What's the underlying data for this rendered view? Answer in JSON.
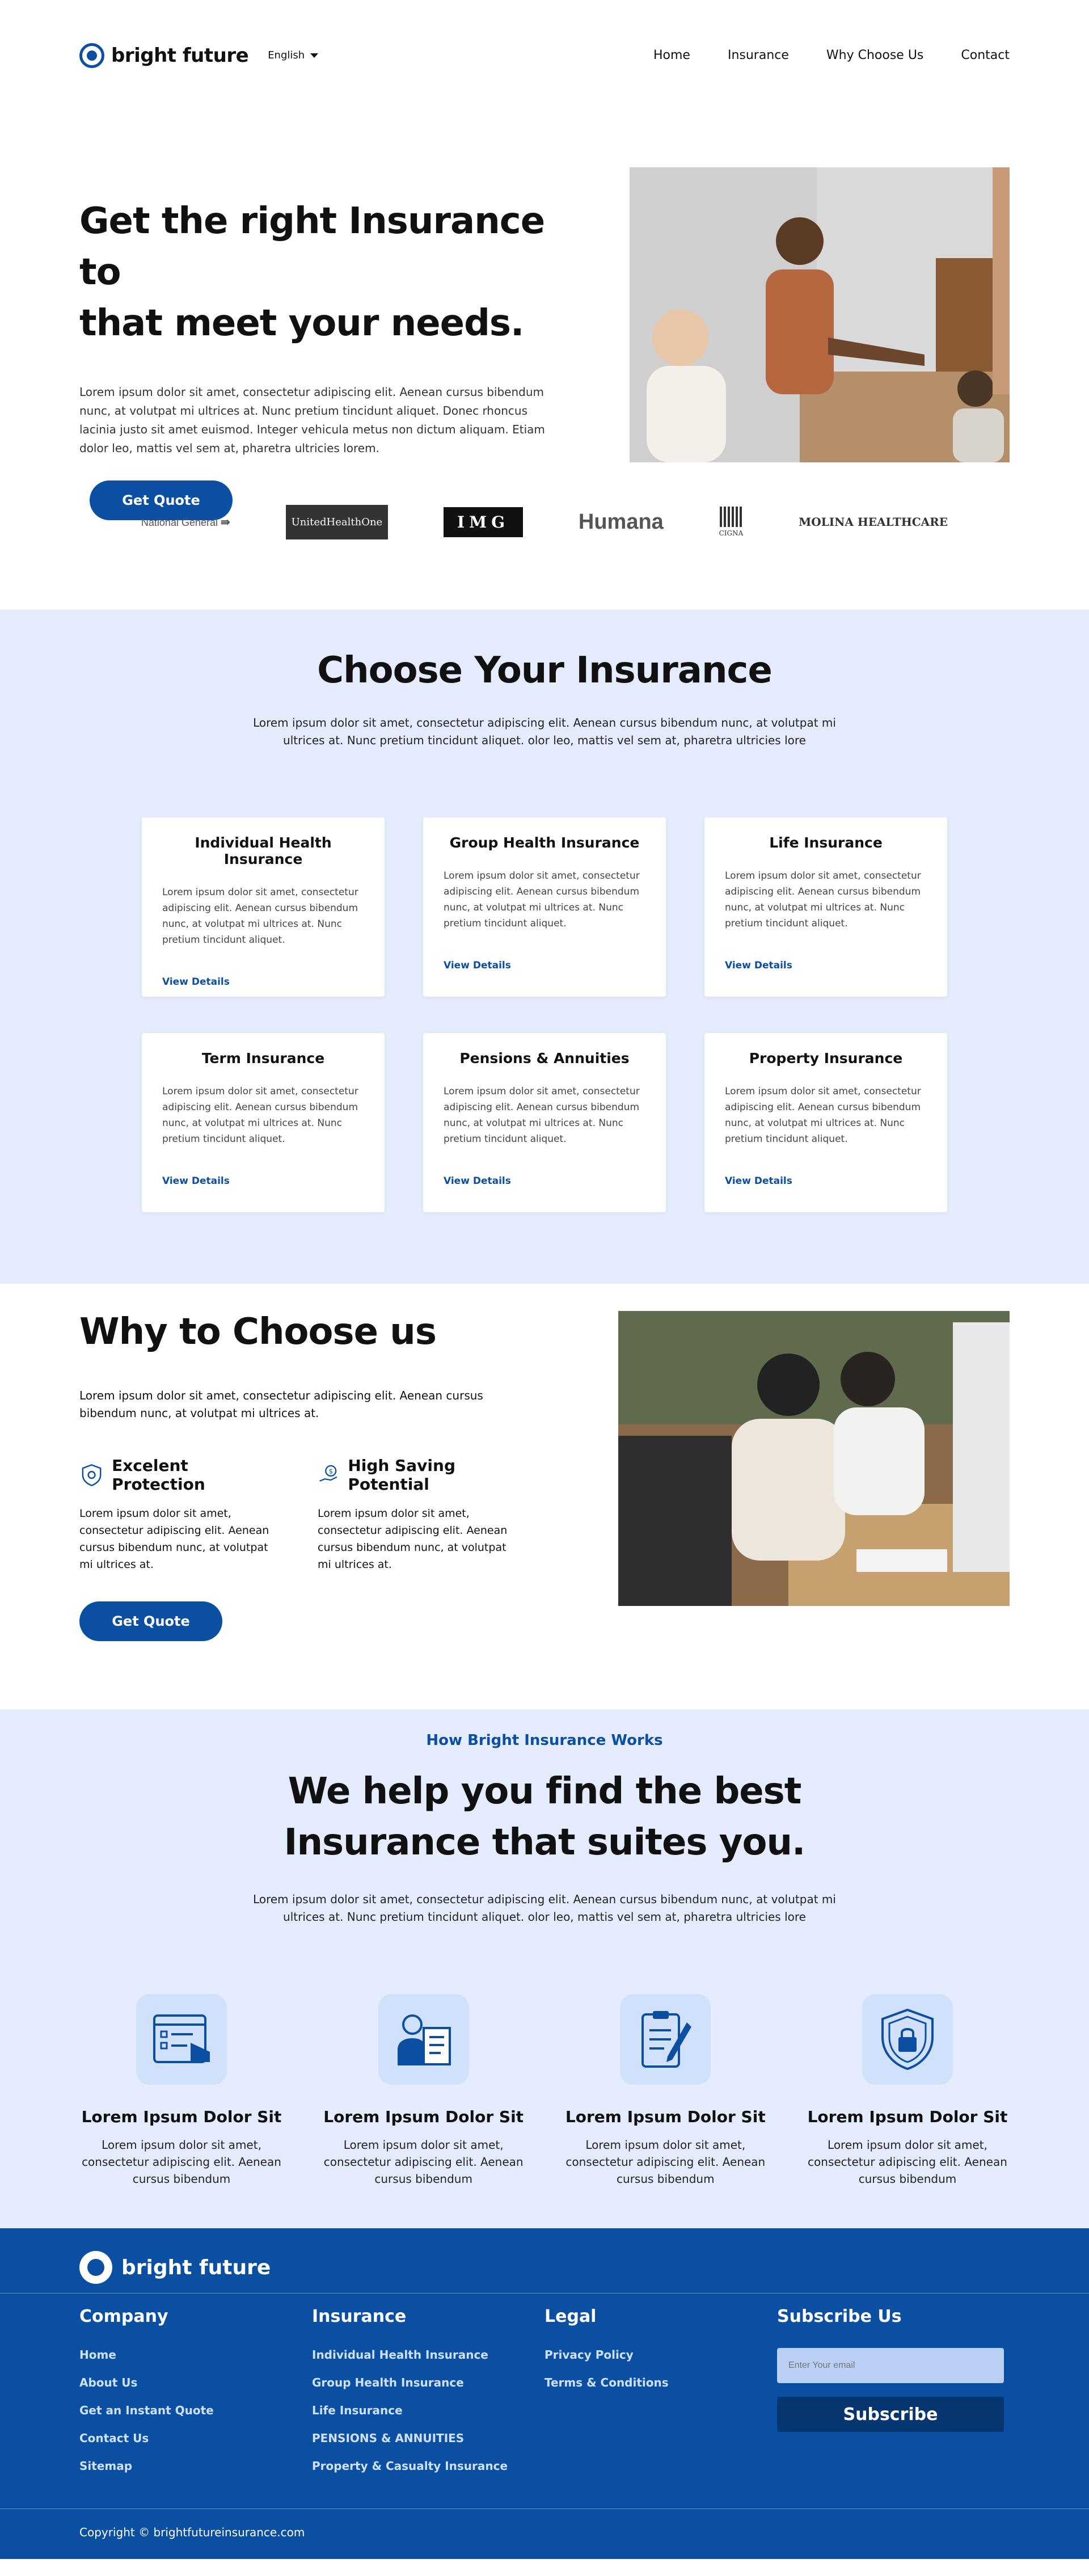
{
  "header": {
    "brand": "bright future",
    "language": "English",
    "nav": [
      "Home",
      "Insurance",
      "Why Choose Us",
      "Contact"
    ]
  },
  "hero": {
    "title_line1": "Get the right Insurance to",
    "title_line2": "that meet your needs.",
    "description": "Lorem ipsum dolor sit amet, consectetur adipiscing elit. Aenean cursus bibendum nunc, at volutpat mi ultrices at. Nunc pretium tincidunt aliquet. Donec rhoncus lacinia justo sit amet euismod. Integer vehicula metus non dictum aliquam. Etiam dolor leo, mattis vel sem at, pharetra ultricies lorem.",
    "cta": "Get Quote"
  },
  "logos": [
    "National General",
    "UnitedHealthOne",
    "IMG",
    "Humana",
    "CIGNA",
    "MOLINA HEALTHCARE"
  ],
  "choose": {
    "title": "Choose Your Insurance",
    "description": "Lorem ipsum dolor sit amet, consectetur adipiscing elit. Aenean cursus bibendum nunc, at volutpat mi ultrices at. Nunc pretium tincidunt aliquet. olor leo, mattis vel sem at, pharetra ultricies lore",
    "cards": [
      {
        "title": "Individual Health Insurance",
        "text": "Lorem ipsum dolor sit amet, consectetur adipiscing elit. Aenean cursus bibendum nunc, at volutpat mi ultrices at. Nunc pretium tincidunt aliquet.",
        "link": "View Details"
      },
      {
        "title": "Group Health Insurance",
        "text": "Lorem ipsum dolor sit amet, consectetur adipiscing elit. Aenean cursus bibendum nunc, at volutpat mi ultrices at. Nunc pretium tincidunt aliquet.",
        "link": "View Details"
      },
      {
        "title": "Life Insurance",
        "text": "Lorem ipsum dolor sit amet, consectetur adipiscing elit. Aenean cursus bibendum nunc, at volutpat mi ultrices at. Nunc pretium tincidunt aliquet.",
        "link": "View Details"
      },
      {
        "title": "Term Insurance",
        "text": "Lorem ipsum dolor sit amet, consectetur adipiscing elit. Aenean cursus bibendum nunc, at volutpat mi ultrices at. Nunc pretium tincidunt aliquet.",
        "link": "View Details"
      },
      {
        "title": "Pensions & Annuities",
        "text": "Lorem ipsum dolor sit amet, consectetur adipiscing elit. Aenean cursus bibendum nunc, at volutpat mi ultrices at. Nunc pretium tincidunt aliquet.",
        "link": "View Details"
      },
      {
        "title": "Property Insurance",
        "text": "Lorem ipsum dolor sit amet, consectetur adipiscing elit. Aenean cursus bibendum nunc, at volutpat mi ultrices at. Nunc pretium tincidunt aliquet.",
        "link": "View Details"
      }
    ]
  },
  "why": {
    "title": "Why to Choose us",
    "description": "Lorem ipsum dolor sit amet, consectetur adipiscing elit. Aenean cursus bibendum nunc, at volutpat mi ultrices at.",
    "features": [
      {
        "title": "Excelent Protection",
        "text": "Lorem ipsum dolor sit amet, consectetur adipiscing elit. Aenean cursus bibendum nunc, at volutpat mi ultrices at.",
        "icon": "shield-icon"
      },
      {
        "title": "High Saving Potential",
        "text": "Lorem ipsum dolor sit amet, consectetur adipiscing elit. Aenean cursus bibendum nunc, at volutpat mi ultrices at.",
        "icon": "money-hand-icon"
      }
    ],
    "cta": "Get Quote"
  },
  "how": {
    "kicker": "How Bright Insurance Works",
    "title_line1": "We help you find the best",
    "title_line2": "Insurance that suites you.",
    "description": "Lorem ipsum dolor sit amet, consectetur adipiscing elit. Aenean cursus bibendum nunc, at volutpat mi ultrices at. Nunc pretium tincidunt aliquet. olor leo, mattis vel sem at, pharetra ultricies lore",
    "steps": [
      {
        "title": "Lorem Ipsum Dolor Sit",
        "text": "Lorem ipsum dolor sit amet, consectetur adipiscing elit. Aenean cursus bibendum",
        "icon": "form-click-icon"
      },
      {
        "title": "Lorem Ipsum Dolor Sit",
        "text": "Lorem ipsum dolor sit amet, consectetur adipiscing elit. Aenean cursus bibendum",
        "icon": "agent-document-icon"
      },
      {
        "title": "Lorem Ipsum Dolor Sit",
        "text": "Lorem ipsum dolor sit amet, consectetur adipiscing elit. Aenean cursus bibendum",
        "icon": "clipboard-pen-icon"
      },
      {
        "title": "Lorem Ipsum Dolor Sit",
        "text": "Lorem ipsum dolor sit amet, consectetur adipiscing elit. Aenean cursus bibendum",
        "icon": "shield-lock-icon"
      }
    ]
  },
  "footer": {
    "brand": "bright future",
    "columns": [
      {
        "title": "Company",
        "items": [
          "Home",
          "About Us",
          "Get an Instant Quote",
          "Contact Us",
          "Sitemap"
        ]
      },
      {
        "title": "Insurance",
        "items": [
          "Individual Health Insurance",
          "Group Health Insurance",
          "Life Insurance",
          "PENSIONS & ANNUITIES",
          "Property & Casualty Insurance"
        ]
      },
      {
        "title": "Legal",
        "items": [
          "Privacy Policy",
          "Terms & Conditions"
        ]
      }
    ],
    "subscribe": {
      "title": "Subscribe Us",
      "placeholder": "Enter Your email",
      "button": "Subscribe"
    },
    "copyright": "Copyright © brightfutureinsurance.com"
  },
  "colors": {
    "primary": "#0b4fa2",
    "section_bg": "#e5ecfd",
    "icon_bg": "#d2e1fb"
  }
}
